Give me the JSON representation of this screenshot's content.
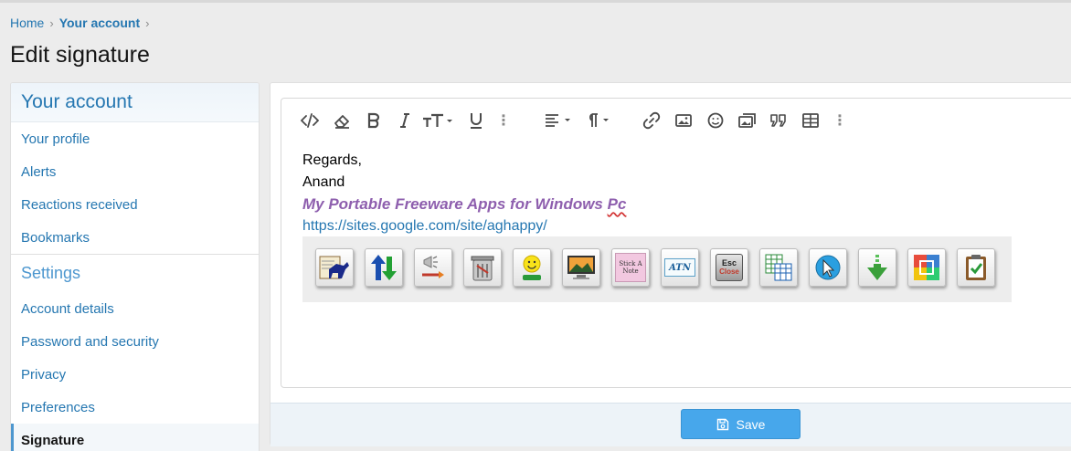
{
  "breadcrumb": {
    "home": "Home",
    "account": "Your account",
    "sep": "›"
  },
  "page_title": "Edit signature",
  "sidebar": {
    "heading": "Your account",
    "group1": [
      "Your profile",
      "Alerts",
      "Reactions received",
      "Bookmarks"
    ],
    "settings_heading": "Settings",
    "group2": [
      "Account details",
      "Password and security",
      "Privacy",
      "Preferences",
      "Signature"
    ]
  },
  "editor": {
    "toolbar_icons": [
      "code-icon",
      "eraser-icon",
      "bold-icon",
      "italic-icon",
      "text-size-icon",
      "underline-icon",
      "more-icon",
      "align-icon",
      "paragraph-icon",
      "link-icon",
      "image-icon",
      "smiley-icon",
      "media-icon",
      "quote-icon",
      "table-icon",
      "more-icon"
    ],
    "content": {
      "line1": "Regards,",
      "line2": "Anand",
      "apps_text": "My Portable Freeware Apps for Windows ",
      "apps_pc": "Pc",
      "link": "https://sites.google.com/site/aghappy/"
    },
    "app_icons": {
      "stick_a_note": "Stick A Note",
      "atn": "ATN",
      "esc": "Esc",
      "close": "Close"
    }
  },
  "footer": {
    "save_label": "Save"
  },
  "colors": {
    "accent": "#2577b1",
    "button": "#47a7eb",
    "apps_text": "#8e5fae"
  }
}
